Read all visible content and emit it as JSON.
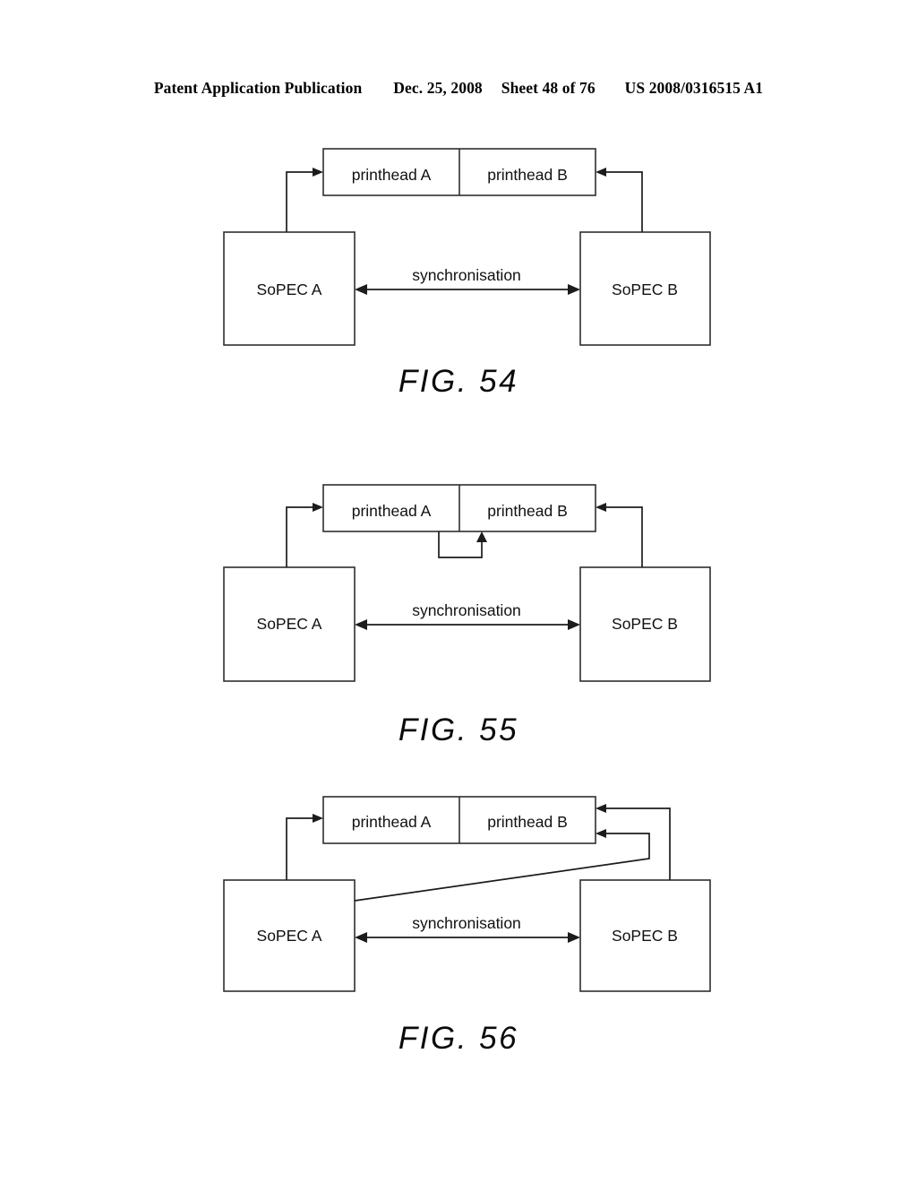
{
  "header": {
    "publication": "Patent Application Publication",
    "date": "Dec. 25, 2008",
    "sheet": "Sheet 48 of 76",
    "patent_number": "US 2008/0316515 A1"
  },
  "figures": [
    {
      "id": "fig-54",
      "caption": "FIG. 54",
      "blocks": {
        "printhead_a": "printhead A",
        "printhead_b": "printhead B",
        "sopec_a": "SoPEC A",
        "sopec_b": "SoPEC B"
      },
      "labels": {
        "sync": "synchronisation"
      }
    },
    {
      "id": "fig-55",
      "caption": "FIG. 55",
      "blocks": {
        "printhead_a": "printhead A",
        "printhead_b": "printhead B",
        "sopec_a": "SoPEC A",
        "sopec_b": "SoPEC B"
      },
      "labels": {
        "sync": "synchronisation"
      }
    },
    {
      "id": "fig-56",
      "caption": "FIG. 56",
      "blocks": {
        "printhead_a": "printhead A",
        "printhead_b": "printhead B",
        "sopec_a": "SoPEC A",
        "sopec_b": "SoPEC B"
      },
      "labels": {
        "sync": "synchronisation"
      }
    }
  ],
  "colors": {
    "page_background": "#ffffff",
    "ink": "#111111",
    "line": "#2e2e2e"
  }
}
